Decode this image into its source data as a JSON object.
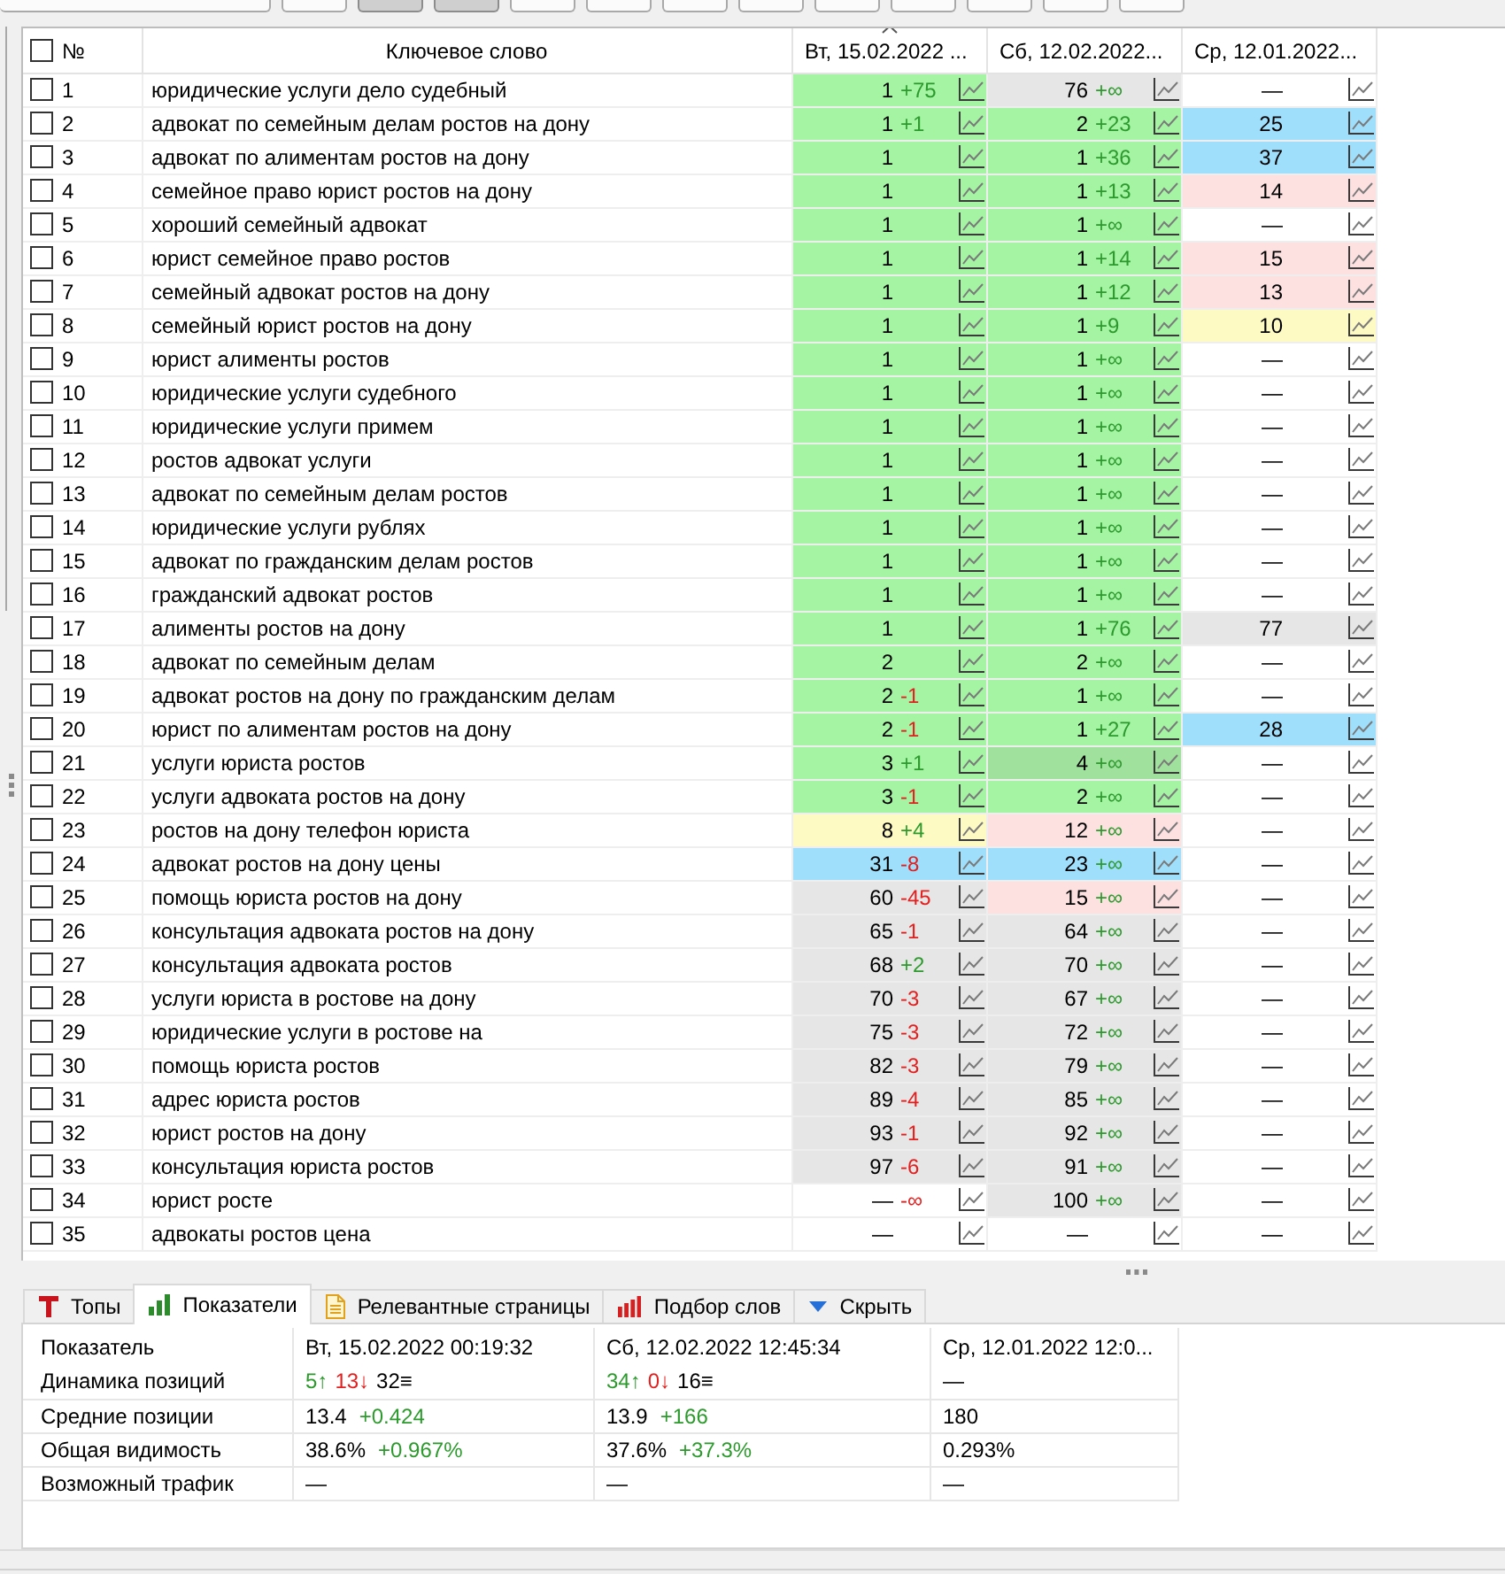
{
  "toolbar": [
    {
      "kind": "wide",
      "pressed": false
    },
    {
      "kind": "small",
      "pressed": false
    },
    {
      "kind": "small",
      "pressed": true
    },
    {
      "kind": "small",
      "pressed": true
    },
    {
      "kind": "small",
      "pressed": false
    },
    {
      "kind": "small",
      "pressed": false
    },
    {
      "kind": "small",
      "pressed": false
    },
    {
      "kind": "small",
      "pressed": false
    },
    {
      "kind": "small",
      "pressed": false
    },
    {
      "kind": "small",
      "pressed": false
    },
    {
      "kind": "small",
      "pressed": false
    },
    {
      "kind": "small",
      "pressed": false
    },
    {
      "kind": "small",
      "pressed": false
    }
  ],
  "keywords_table": {
    "select_all": {
      "checked": false
    },
    "columns": [
      {
        "label": "№",
        "sorted": false
      },
      {
        "label": "Ключевое слово",
        "sorted": false
      },
      {
        "label": "Вт, 15.02.2022 ...",
        "sorted": true
      },
      {
        "label": "Сб, 12.02.2022...",
        "sorted": false
      },
      {
        "label": "Ср, 12.01.2022...",
        "sorted": false
      }
    ],
    "rows": [
      {
        "checked": false,
        "number": "1",
        "keyword": "юридические услуги дело судебный",
        "positions": [
          {
            "value": "1",
            "delta": "+75",
            "rising": true,
            "color": "#a4f4a4"
          },
          {
            "value": "76",
            "delta": "+∞",
            "rising": true,
            "color": "#e6e6e6"
          },
          {
            "value": "—"
          }
        ]
      },
      {
        "checked": false,
        "number": "2",
        "keyword": "адвокат по семейным делам ростов на дону",
        "positions": [
          {
            "value": "1",
            "delta": "+1",
            "rising": true,
            "color": "#a4f4a4"
          },
          {
            "value": "2",
            "delta": "+23",
            "rising": true,
            "color": "#a4f4a4"
          },
          {
            "value": "25",
            "color": "#9fdffb"
          }
        ]
      },
      {
        "checked": false,
        "number": "3",
        "keyword": "адвокат по алиментам ростов на дону",
        "positions": [
          {
            "value": "1",
            "color": "#a4f4a4"
          },
          {
            "value": "1",
            "delta": "+36",
            "rising": true,
            "color": "#a4f4a4"
          },
          {
            "value": "37",
            "color": "#9fdffb"
          }
        ]
      },
      {
        "checked": false,
        "number": "4",
        "keyword": "семейное право юрист ростов на дону",
        "positions": [
          {
            "value": "1",
            "color": "#a4f4a4"
          },
          {
            "value": "1",
            "delta": "+13",
            "rising": true,
            "color": "#a4f4a4"
          },
          {
            "value": "14",
            "color": "#fde1e1"
          }
        ]
      },
      {
        "checked": false,
        "number": "5",
        "keyword": "хороший семейный адвокат",
        "positions": [
          {
            "value": "1",
            "color": "#a4f4a4"
          },
          {
            "value": "1",
            "delta": "+∞",
            "rising": true,
            "color": "#a4f4a4"
          },
          {
            "value": "—"
          }
        ]
      },
      {
        "checked": false,
        "number": "6",
        "keyword": "юрист семейное право ростов",
        "positions": [
          {
            "value": "1",
            "color": "#a4f4a4"
          },
          {
            "value": "1",
            "delta": "+14",
            "rising": true,
            "color": "#a4f4a4"
          },
          {
            "value": "15",
            "color": "#fde1e1"
          }
        ]
      },
      {
        "checked": false,
        "number": "7",
        "keyword": "семейный адвокат ростов на дону",
        "positions": [
          {
            "value": "1",
            "color": "#a4f4a4"
          },
          {
            "value": "1",
            "delta": "+12",
            "rising": true,
            "color": "#a4f4a4"
          },
          {
            "value": "13",
            "color": "#fde1e1"
          }
        ]
      },
      {
        "checked": false,
        "number": "8",
        "keyword": "семейный юрист ростов на дону",
        "positions": [
          {
            "value": "1",
            "color": "#a4f4a4"
          },
          {
            "value": "1",
            "delta": "+9",
            "rising": true,
            "color": "#a4f4a4"
          },
          {
            "value": "10",
            "color": "#fefac4"
          }
        ]
      },
      {
        "checked": false,
        "number": "9",
        "keyword": "юрист алименты ростов",
        "positions": [
          {
            "value": "1",
            "color": "#a4f4a4"
          },
          {
            "value": "1",
            "delta": "+∞",
            "rising": true,
            "color": "#a4f4a4"
          },
          {
            "value": "—"
          }
        ]
      },
      {
        "checked": false,
        "number": "10",
        "keyword": "юридические услуги судебного",
        "positions": [
          {
            "value": "1",
            "color": "#a4f4a4"
          },
          {
            "value": "1",
            "delta": "+∞",
            "rising": true,
            "color": "#a4f4a4"
          },
          {
            "value": "—"
          }
        ]
      },
      {
        "checked": false,
        "number": "11",
        "keyword": "юридические услуги примем",
        "positions": [
          {
            "value": "1",
            "color": "#a4f4a4"
          },
          {
            "value": "1",
            "delta": "+∞",
            "rising": true,
            "color": "#a4f4a4"
          },
          {
            "value": "—"
          }
        ]
      },
      {
        "checked": false,
        "number": "12",
        "keyword": "ростов адвокат услуги",
        "positions": [
          {
            "value": "1",
            "color": "#a4f4a4"
          },
          {
            "value": "1",
            "delta": "+∞",
            "rising": true,
            "color": "#a4f4a4"
          },
          {
            "value": "—"
          }
        ]
      },
      {
        "checked": false,
        "number": "13",
        "keyword": "адвокат по семейным делам ростов",
        "positions": [
          {
            "value": "1",
            "color": "#a4f4a4"
          },
          {
            "value": "1",
            "delta": "+∞",
            "rising": true,
            "color": "#a4f4a4"
          },
          {
            "value": "—"
          }
        ]
      },
      {
        "checked": false,
        "number": "14",
        "keyword": "юридические услуги рублях",
        "positions": [
          {
            "value": "1",
            "color": "#a4f4a4"
          },
          {
            "value": "1",
            "delta": "+∞",
            "rising": true,
            "color": "#a4f4a4"
          },
          {
            "value": "—"
          }
        ]
      },
      {
        "checked": false,
        "number": "15",
        "keyword": "адвокат по гражданским делам ростов",
        "positions": [
          {
            "value": "1",
            "color": "#a4f4a4"
          },
          {
            "value": "1",
            "delta": "+∞",
            "rising": true,
            "color": "#a4f4a4"
          },
          {
            "value": "—"
          }
        ]
      },
      {
        "checked": false,
        "number": "16",
        "keyword": "гражданский адвокат ростов",
        "positions": [
          {
            "value": "1",
            "color": "#a4f4a4"
          },
          {
            "value": "1",
            "delta": "+∞",
            "rising": true,
            "color": "#a4f4a4"
          },
          {
            "value": "—"
          }
        ]
      },
      {
        "checked": false,
        "number": "17",
        "keyword": "алименты ростов на дону",
        "positions": [
          {
            "value": "1",
            "color": "#a4f4a4"
          },
          {
            "value": "1",
            "delta": "+76",
            "rising": true,
            "color": "#a4f4a4"
          },
          {
            "value": "77",
            "color": "#e6e6e6"
          }
        ]
      },
      {
        "checked": false,
        "number": "18",
        "keyword": "адвокат по семейным делам",
        "positions": [
          {
            "value": "2",
            "color": "#a4f4a4"
          },
          {
            "value": "2",
            "delta": "+∞",
            "rising": true,
            "color": "#a4f4a4"
          },
          {
            "value": "—"
          }
        ]
      },
      {
        "checked": false,
        "number": "19",
        "keyword": "адвокат ростов на дону по гражданским делам",
        "positions": [
          {
            "value": "2",
            "delta": "-1",
            "rising": false,
            "color": "#a4f4a4"
          },
          {
            "value": "1",
            "delta": "+∞",
            "rising": true,
            "color": "#a4f4a4"
          },
          {
            "value": "—"
          }
        ]
      },
      {
        "checked": false,
        "number": "20",
        "keyword": "юрист по алиментам ростов на дону",
        "positions": [
          {
            "value": "2",
            "delta": "-1",
            "rising": false,
            "color": "#a4f4a4"
          },
          {
            "value": "1",
            "delta": "+27",
            "rising": true,
            "color": "#a4f4a4"
          },
          {
            "value": "28",
            "color": "#9fdffb"
          }
        ]
      },
      {
        "checked": false,
        "number": "21",
        "keyword": "услуги юриста ростов",
        "positions": [
          {
            "value": "3",
            "delta": "+1",
            "rising": true,
            "color": "#a4f4a4"
          },
          {
            "value": "4",
            "delta": "+∞",
            "rising": true,
            "color": "#a0e19d"
          },
          {
            "value": "—"
          }
        ]
      },
      {
        "checked": false,
        "number": "22",
        "keyword": "услуги адвоката ростов на дону",
        "positions": [
          {
            "value": "3",
            "delta": "-1",
            "rising": false,
            "color": "#a4f4a4"
          },
          {
            "value": "2",
            "delta": "+∞",
            "rising": true,
            "color": "#a4f4a4"
          },
          {
            "value": "—"
          }
        ]
      },
      {
        "checked": false,
        "number": "23",
        "keyword": "ростов на дону телефон юриста",
        "positions": [
          {
            "value": "8",
            "delta": "+4",
            "rising": true,
            "color": "#fefac4"
          },
          {
            "value": "12",
            "delta": "+∞",
            "rising": true,
            "color": "#fde1e1"
          },
          {
            "value": "—"
          }
        ]
      },
      {
        "checked": false,
        "number": "24",
        "keyword": "адвокат ростов на дону цены",
        "positions": [
          {
            "value": "31",
            "delta": "-8",
            "rising": false,
            "color": "#9fdffb"
          },
          {
            "value": "23",
            "delta": "+∞",
            "rising": true,
            "color": "#9fdffb"
          },
          {
            "value": "—"
          }
        ]
      },
      {
        "checked": false,
        "number": "25",
        "keyword": "помощь юриста ростов на дону",
        "positions": [
          {
            "value": "60",
            "delta": "-45",
            "rising": false,
            "color": "#e6e6e6"
          },
          {
            "value": "15",
            "delta": "+∞",
            "rising": true,
            "color": "#fde1e1"
          },
          {
            "value": "—"
          }
        ]
      },
      {
        "checked": false,
        "number": "26",
        "keyword": "консультация адвоката ростов на дону",
        "positions": [
          {
            "value": "65",
            "delta": "-1",
            "rising": false,
            "color": "#e6e6e6"
          },
          {
            "value": "64",
            "delta": "+∞",
            "rising": true,
            "color": "#e6e6e6"
          },
          {
            "value": "—"
          }
        ]
      },
      {
        "checked": false,
        "number": "27",
        "keyword": "консультация адвоката ростов",
        "positions": [
          {
            "value": "68",
            "delta": "+2",
            "rising": true,
            "color": "#e6e6e6"
          },
          {
            "value": "70",
            "delta": "+∞",
            "rising": true,
            "color": "#e6e6e6"
          },
          {
            "value": "—"
          }
        ]
      },
      {
        "checked": false,
        "number": "28",
        "keyword": "услуги юриста в ростове на дону",
        "positions": [
          {
            "value": "70",
            "delta": "-3",
            "rising": false,
            "color": "#e6e6e6"
          },
          {
            "value": "67",
            "delta": "+∞",
            "rising": true,
            "color": "#e6e6e6"
          },
          {
            "value": "—"
          }
        ]
      },
      {
        "checked": false,
        "number": "29",
        "keyword": "юридические услуги в ростове на",
        "positions": [
          {
            "value": "75",
            "delta": "-3",
            "rising": false,
            "color": "#e6e6e6"
          },
          {
            "value": "72",
            "delta": "+∞",
            "rising": true,
            "color": "#e6e6e6"
          },
          {
            "value": "—"
          }
        ]
      },
      {
        "checked": false,
        "number": "30",
        "keyword": "помощь юриста ростов",
        "positions": [
          {
            "value": "82",
            "delta": "-3",
            "rising": false,
            "color": "#e6e6e6"
          },
          {
            "value": "79",
            "delta": "+∞",
            "rising": true,
            "color": "#e6e6e6"
          },
          {
            "value": "—"
          }
        ]
      },
      {
        "checked": false,
        "number": "31",
        "keyword": "адрес юриста ростов",
        "positions": [
          {
            "value": "89",
            "delta": "-4",
            "rising": false,
            "color": "#e6e6e6"
          },
          {
            "value": "85",
            "delta": "+∞",
            "rising": true,
            "color": "#e6e6e6"
          },
          {
            "value": "—"
          }
        ]
      },
      {
        "checked": false,
        "number": "32",
        "keyword": "юрист ростов на дону",
        "positions": [
          {
            "value": "93",
            "delta": "-1",
            "rising": false,
            "color": "#e6e6e6"
          },
          {
            "value": "92",
            "delta": "+∞",
            "rising": true,
            "color": "#e6e6e6"
          },
          {
            "value": "—"
          }
        ]
      },
      {
        "checked": false,
        "number": "33",
        "keyword": "консультация юриста ростов",
        "positions": [
          {
            "value": "97",
            "delta": "-6",
            "rising": false,
            "color": "#e6e6e6"
          },
          {
            "value": "91",
            "delta": "+∞",
            "rising": true,
            "color": "#e6e6e6"
          },
          {
            "value": "—"
          }
        ]
      },
      {
        "checked": false,
        "number": "34",
        "keyword": "юрист росте",
        "positions": [
          {
            "value": "—",
            "delta": "-∞",
            "rising": false
          },
          {
            "value": "100",
            "delta": "+∞",
            "rising": true,
            "color": "#e6e6e6"
          },
          {
            "value": "—"
          }
        ]
      },
      {
        "checked": false,
        "number": "35",
        "keyword": "адвокаты ростов цена",
        "positions": [
          {
            "value": "—"
          },
          {
            "value": "—"
          },
          {
            "value": "—"
          }
        ]
      }
    ]
  },
  "bottom_panel": {
    "tabs": [
      {
        "label": "Топы",
        "selected": false
      },
      {
        "label": "Показатели",
        "selected": true
      },
      {
        "label": "Релевантные страницы",
        "selected": false
      },
      {
        "label": "Подбор слов",
        "selected": false
      },
      {
        "label": "Скрыть",
        "selected": false
      }
    ],
    "metrics": {
      "columns": [
        "Показатель",
        "Вт, 15.02.2022 00:19:32",
        "Сб, 12.02.2022 12:45:34",
        "Ср, 12.01.2022 12:0..."
      ],
      "rows": [
        {
          "cells": [
            {
              "value": "Динамика позиций"
            },
            {
              "parts": [
                {
                  "text": "5↑",
                  "kind": "up"
                },
                {
                  "text": "13↓",
                  "kind": "down"
                },
                {
                  "text": "32≡",
                  "kind": "same"
                }
              ]
            },
            {
              "parts": [
                {
                  "text": "34↑",
                  "kind": "up"
                },
                {
                  "text": "0↓",
                  "kind": "down"
                },
                {
                  "text": "16≡",
                  "kind": "same"
                }
              ]
            },
            {
              "value": "—"
            }
          ]
        },
        {
          "cells": [
            {
              "value": "Средние позиции"
            },
            {
              "value": "13.4",
              "delta": "+0.424",
              "rising": true
            },
            {
              "value": "13.9",
              "delta": "+166",
              "rising": true
            },
            {
              "value": "180"
            }
          ]
        },
        {
          "cells": [
            {
              "value": "Общая видимость"
            },
            {
              "value": "38.6%",
              "delta": "+0.967%",
              "rising": true
            },
            {
              "value": "37.6%",
              "delta": "+37.3%",
              "rising": true
            },
            {
              "value": "0.293%"
            }
          ]
        },
        {
          "cells": [
            {
              "value": "Возможный трафик"
            },
            {
              "value": "—"
            },
            {
              "value": "—"
            },
            {
              "value": "—"
            }
          ]
        }
      ]
    }
  }
}
